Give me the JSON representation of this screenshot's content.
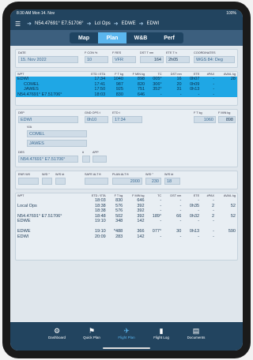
{
  "status": {
    "time": "8:30 AM",
    "date": "Mon 14. Nov",
    "battery": "100%"
  },
  "nav": {
    "from": "N54.47691° E7.51706°",
    "via": "Lcl Ops",
    "to1": "EDWE",
    "to2": "EDWI"
  },
  "segments": [
    "Map",
    "Plan",
    "W&B",
    "Perf"
  ],
  "header": {
    "date_label": "DATE",
    "date": "15. Nov 2022",
    "fcon_label": "F CON %",
    "fcon": "10",
    "fres_label": "F RES",
    "fres": "VFR",
    "dst_label": "DST T nm",
    "dst": "164",
    "ete_label": "ETE T h",
    "ete": "2h05",
    "coord_label": "COORDINATES",
    "coord": "WGS 84: Deg"
  },
  "route_table": {
    "headers": [
      "WPT",
      "ETD / ETA",
      "F T kg",
      "F MIN kg",
      "TC",
      "DST nm",
      "ETE",
      "#PAX",
      "AVAIL kg"
    ],
    "rows": [
      [
        "EDWI",
        "17:34",
        "1040",
        "898",
        "005°",
        "16",
        "0h07",
        "-",
        "28"
      ],
      [
        "COMEL",
        "17:41",
        "987",
        "820",
        "306°",
        "20",
        "0h09",
        "-",
        ""
      ],
      [
        "JAWES",
        "17:50",
        "925",
        "751",
        "352°",
        "31",
        "0h13",
        "-",
        ""
      ],
      [
        "N54.47691° E7.51706°",
        "18:03",
        "830",
        "646",
        "-",
        "-",
        "-",
        "-",
        ""
      ]
    ]
  },
  "dep": {
    "dep_label": "DEP",
    "dep": "EDWI",
    "gnd_label": "GND OPS t",
    "gnd": "0h10",
    "etd_label": "ETD t",
    "etd": "17:34",
    "ft_label": "F T kg",
    "ft": "1060",
    "fmin_label": "F MIN kg",
    "fmin": "898",
    "via_label": "VIA",
    "via1": "COMEL",
    "via2": "JAWES",
    "des_label": "DES",
    "des": "N54.47691° E7.51706°",
    "hash_label": "#",
    "app_label": "APP"
  },
  "wind": {
    "enr_label": "ENR WX",
    "wd_label": "W/D °",
    "ws_label": "W/S kt",
    "safe_label": "SAFE ALT ft",
    "plan_label": "PLAN ALT ft",
    "plan": "2000",
    "wd2_label": "W/D °",
    "wd2": "230",
    "ws2_label": "W/S kt",
    "ws2": "18"
  },
  "legs_table": {
    "headers": [
      "WPT",
      "ETD / ETA",
      "F T kg",
      "F MIN kg",
      "TC",
      "DST nm",
      "ETE",
      "#PAX",
      "AVAIL kg"
    ],
    "rows": [
      [
        "",
        "18:03",
        "830",
        "646",
        "-",
        "-",
        "-",
        "-",
        ""
      ],
      [
        "Local Ops",
        "18:38",
        "576",
        "392",
        "-",
        "-",
        "0h35",
        "2",
        "52"
      ],
      [
        "",
        "18:38",
        "576",
        "392",
        "-",
        "-",
        "-",
        "-",
        ""
      ],
      [
        "N54.47691° E7.51706°",
        "18:48",
        "502",
        "392",
        "189°",
        "66",
        "0h32",
        "2",
        "52"
      ],
      [
        "EDWE",
        "19:10",
        "348",
        "142",
        "-",
        "-",
        "-",
        "-",
        ""
      ],
      [
        "",
        "",
        "",
        "",
        "",
        "",
        "",
        "",
        ""
      ],
      [
        "EDWE",
        "19:10",
        "*488",
        "366",
        "077°",
        "30",
        "0h13",
        "-",
        "590"
      ],
      [
        "EDWI",
        "20:09",
        "283",
        "142",
        "-",
        "-",
        "-",
        "-",
        ""
      ]
    ]
  },
  "tabs": [
    {
      "label": "Dashboard",
      "icon": "⚙"
    },
    {
      "label": "Quick Plan",
      "icon": "⚑"
    },
    {
      "label": "Flight Plan",
      "icon": "✈"
    },
    {
      "label": "Flight Log",
      "icon": "▮"
    },
    {
      "label": "Documents",
      "icon": "▤"
    }
  ]
}
